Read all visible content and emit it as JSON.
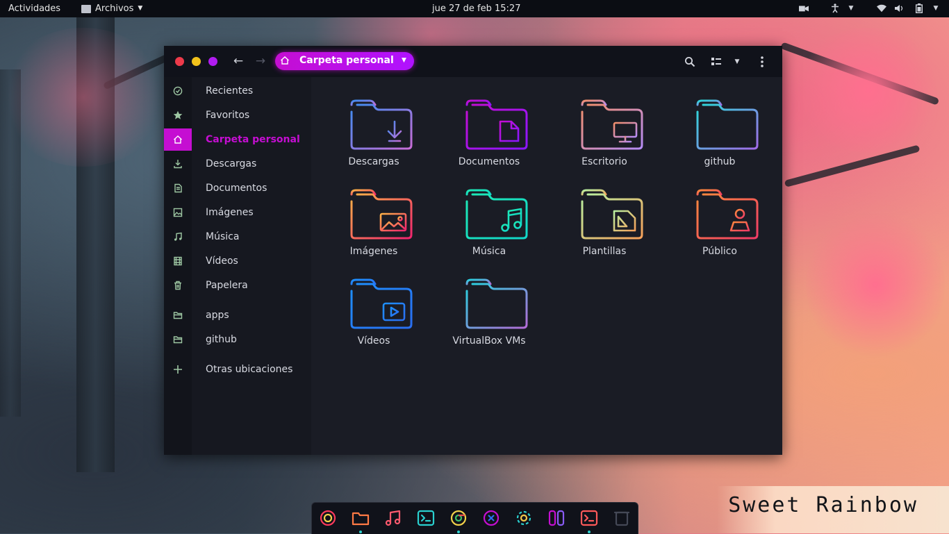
{
  "topbar": {
    "activities": "Actividades",
    "app_menu": "Archivos",
    "clock": "jue 27 de feb  15:27"
  },
  "window": {
    "path_label": "Carpeta personal"
  },
  "sidebar": {
    "items": [
      {
        "label": "Recientes",
        "icon": "clock-icon"
      },
      {
        "label": "Favoritos",
        "icon": "star-icon"
      },
      {
        "label": "Carpeta personal",
        "icon": "home-icon",
        "active": true
      },
      {
        "label": "Descargas",
        "icon": "download-icon"
      },
      {
        "label": "Documentos",
        "icon": "document-icon"
      },
      {
        "label": "Imágenes",
        "icon": "image-icon"
      },
      {
        "label": "Música",
        "icon": "music-icon"
      },
      {
        "label": "Vídeos",
        "icon": "film-icon"
      },
      {
        "label": "Papelera",
        "icon": "trash-icon"
      }
    ],
    "bookmarks": [
      {
        "label": "apps",
        "icon": "folder-icon"
      },
      {
        "label": "github",
        "icon": "folder-icon"
      }
    ],
    "other": {
      "label": "Otras ubicaciones",
      "icon": "plus-icon"
    }
  },
  "folders": [
    {
      "label": "Descargas",
      "glyph": "download",
      "colors": [
        "#3f8cf0",
        "#c86dd7"
      ]
    },
    {
      "label": "Documentos",
      "glyph": "document",
      "colors": [
        "#c50ed2",
        "#8a17ff"
      ]
    },
    {
      "label": "Escritorio",
      "glyph": "monitor",
      "colors": [
        "#f28f6b",
        "#b58cf5"
      ]
    },
    {
      "label": "github",
      "glyph": "none",
      "colors": [
        "#2bd9d9",
        "#a26be8"
      ]
    },
    {
      "label": "Imágenes",
      "glyph": "image",
      "colors": [
        "#ffb347",
        "#f0246e"
      ]
    },
    {
      "label": "Música",
      "glyph": "music",
      "colors": [
        "#1de9b6",
        "#12d6c8"
      ]
    },
    {
      "label": "Plantillas",
      "glyph": "template",
      "colors": [
        "#b8f0a0",
        "#f5a05a"
      ]
    },
    {
      "label": "Público",
      "glyph": "person",
      "colors": [
        "#ff8a3d",
        "#ef3b66"
      ]
    },
    {
      "label": "Vídeos",
      "glyph": "play",
      "colors": [
        "#1e90ff",
        "#2a6ef0"
      ]
    },
    {
      "label": "VirtualBox VMs",
      "glyph": "none",
      "colors": [
        "#27d3e0",
        "#b36bd6"
      ]
    }
  ],
  "dock": {
    "apps": [
      {
        "name": "firefox-icon",
        "color": "#ff3a5c",
        "running": false
      },
      {
        "name": "files-icon",
        "color": "#ff7a45",
        "running": true
      },
      {
        "name": "music-player-icon",
        "color": "#ff5a6e",
        "running": false
      },
      {
        "name": "terminal-icon",
        "color": "#2ad1d0",
        "running": false
      },
      {
        "name": "chrome-icon",
        "color": "#f2d14a",
        "running": true
      },
      {
        "name": "vscode-icon",
        "color": "#c50ed2",
        "running": false
      },
      {
        "name": "settings-icon",
        "color": "#f2c94c",
        "running": false
      },
      {
        "name": "switch-icon",
        "color": "#8a5cf6",
        "running": false
      },
      {
        "name": "terminal-alt-icon",
        "color": "#ff5a5a",
        "running": true
      },
      {
        "name": "trash-dock-icon",
        "color": "#444856",
        "running": false
      }
    ]
  },
  "brand": {
    "text": "Sweet Rainbow"
  },
  "accent": "#c50ed2"
}
